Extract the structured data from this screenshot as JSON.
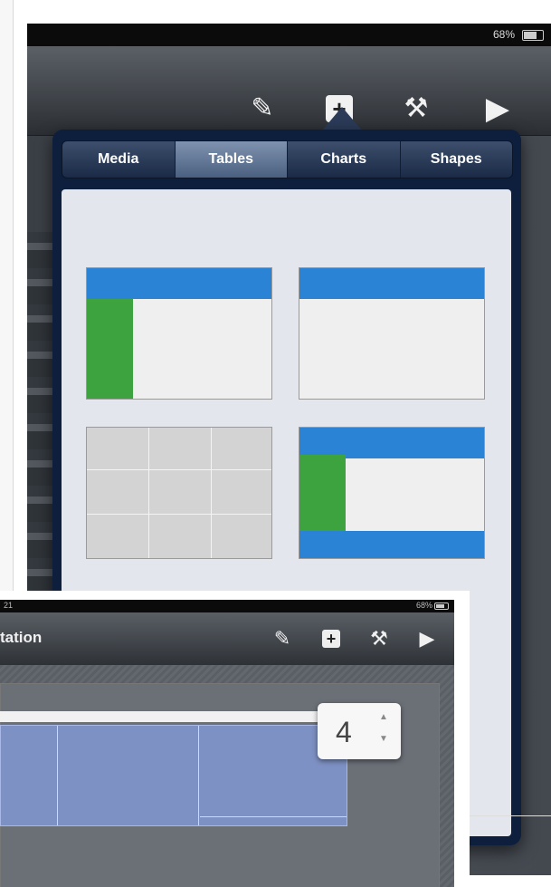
{
  "screen1": {
    "status": {
      "battery": "68%"
    },
    "toolbar": {
      "icons": [
        "paintbrush-icon",
        "add-icon",
        "wrench-icon",
        "play-icon"
      ]
    },
    "popover": {
      "tabs": [
        "Media",
        "Tables",
        "Charts",
        "Shapes"
      ],
      "active_tab": "Tables",
      "table_styles": [
        {
          "style": "header-row-and-column",
          "header_color": "#2b83d6",
          "column_color": "#3da33f"
        },
        {
          "style": "header-row",
          "header_color": "#2b83d6"
        },
        {
          "style": "plain-grid"
        },
        {
          "style": "header-row-column-and-footer",
          "header_color": "#2b83d6",
          "column_color": "#3da33f"
        }
      ]
    }
  },
  "screen2": {
    "status": {
      "time": "21",
      "battery": "68%"
    },
    "toolbar": {
      "title": "tation"
    },
    "stepper": {
      "value": "4",
      "up": "▲",
      "down": "▼"
    }
  }
}
